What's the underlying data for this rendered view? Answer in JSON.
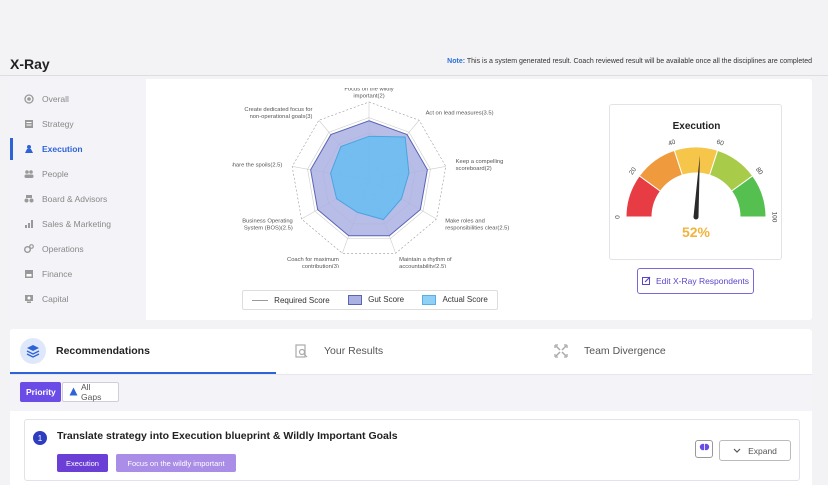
{
  "header": {
    "title": "X-Ray",
    "note_label": "Note:",
    "note_text": " This is a system generated result. Coach reviewed result will be available once all the disciplines are completed"
  },
  "sidebar": {
    "items": [
      {
        "label": "Overall",
        "icon": "target-icon",
        "active": false
      },
      {
        "label": "Strategy",
        "icon": "strategy-icon",
        "active": false
      },
      {
        "label": "Execution",
        "icon": "execution-icon",
        "active": true
      },
      {
        "label": "People",
        "icon": "people-icon",
        "active": false
      },
      {
        "label": "Board & Advisors",
        "icon": "board-icon",
        "active": false
      },
      {
        "label": "Sales & Marketing",
        "icon": "sales-icon",
        "active": false
      },
      {
        "label": "Operations",
        "icon": "operations-icon",
        "active": false
      },
      {
        "label": "Finance",
        "icon": "finance-icon",
        "active": false
      },
      {
        "label": "Capital",
        "icon": "capital-icon",
        "active": false
      }
    ]
  },
  "radar": {
    "labels": [
      "Focus on the wildly|important(2)",
      "Act on lead measures(3.5)",
      "Keep a compelling|scoreboard(2)",
      "Make roles and|responsibilities clear(2.5)",
      "Maintain a rhythm of|accountability(2.5)",
      "Coach for maximum|contribution(3)",
      "Business Operating|System (BOS)(2.5)",
      "Share the spoils(2.5)",
      "Create dedicated focus for|non-operational goals(3)"
    ],
    "gut_scores": [
      3.8,
      3.8,
      3.8,
      3.8,
      3.8,
      3.8,
      3.8,
      3.8,
      3.8
    ],
    "actual_scores": [
      2.8,
      3.6,
      2.6,
      2.4,
      2.7,
      2.2,
      2.4,
      2.5,
      2.8
    ],
    "max": 5,
    "colors": {
      "gut": "#aab2e2",
      "actual": "#6cbcf2"
    }
  },
  "legend": {
    "required": "Required Score",
    "gut": "Gut Score",
    "actual": "Actual Score"
  },
  "gauge": {
    "title": "Execution",
    "value": 52,
    "value_label": "52%",
    "ticks": [
      "0",
      "20",
      "40",
      "60",
      "80",
      "100"
    ],
    "colors": [
      "#e83c44",
      "#f09a3e",
      "#f6c64a",
      "#a8cc4a",
      "#55c050"
    ],
    "value_color": "#f0b43c"
  },
  "edit_button": "Edit X-Ray Respondents",
  "tabs": [
    {
      "label": "Recommendations",
      "active": true
    },
    {
      "label": "Your Results",
      "active": false
    },
    {
      "label": "Team Divergence",
      "active": false
    }
  ],
  "filters": {
    "priority": "Priority",
    "all_gaps": "All Gaps"
  },
  "recommendation": {
    "number": "1",
    "title": "Translate strategy into Execution blueprint & Wildly Important Goals",
    "tags": [
      "Execution",
      "Focus on the wildly important"
    ],
    "expand": "Expand"
  }
}
